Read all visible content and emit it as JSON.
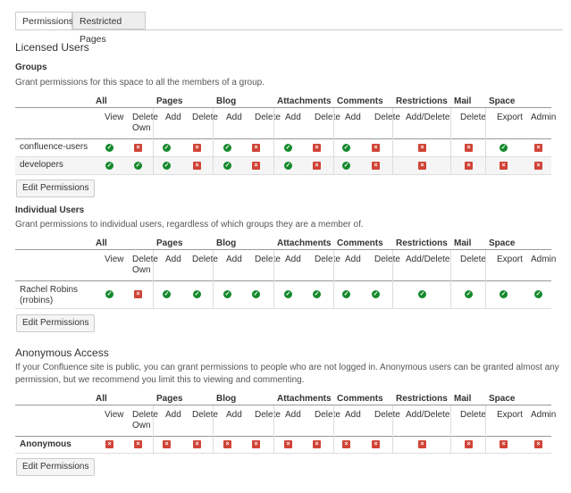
{
  "tabs": [
    {
      "label": "Permissions",
      "active": true
    },
    {
      "label": "Restricted Pages",
      "active": false
    }
  ],
  "licensed_title": "Licensed Users",
  "columns": {
    "groups": [
      "All",
      "Pages",
      "Blog",
      "Attachments",
      "Comments",
      "Restrictions",
      "Mail",
      "Space"
    ],
    "sub": [
      "View",
      "Delete Own",
      "Add",
      "Delete",
      "Add",
      "Delete",
      "Add",
      "Delete",
      "Add",
      "Delete",
      "Add/Delete",
      "Delete",
      "Export",
      "Admin"
    ]
  },
  "sections": [
    {
      "title": "Groups",
      "desc": "Grant permissions for this space to all the members of a group.",
      "rows": [
        {
          "name": "confluence-users",
          "perms": [
            1,
            0,
            1,
            0,
            1,
            0,
            1,
            0,
            1,
            0,
            0,
            0,
            1,
            0
          ]
        },
        {
          "name": "developers",
          "perms": [
            1,
            1,
            1,
            0,
            1,
            0,
            1,
            0,
            1,
            0,
            0,
            0,
            0,
            0
          ]
        }
      ],
      "button": "Edit Permissions"
    },
    {
      "title": "Individual Users",
      "desc": "Grant permissions to individual users, regardless of which groups they are a member of.",
      "rows": [
        {
          "name": "Rachel Robins",
          "name2": "(rrobins)",
          "perms": [
            1,
            0,
            1,
            1,
            1,
            1,
            1,
            1,
            1,
            1,
            1,
            1,
            1,
            1
          ]
        }
      ],
      "button": "Edit Permissions"
    },
    {
      "title": "Anonymous Access",
      "desc": "If your Confluence site is public, you can grant permissions to people who are not logged in. Anonymous users can be granted almost any permission, but we recommend you limit this to viewing and commenting.",
      "rows": [
        {
          "name": "Anonymous",
          "perms": [
            0,
            0,
            0,
            0,
            0,
            0,
            0,
            0,
            0,
            0,
            0,
            0,
            0,
            0
          ]
        }
      ],
      "button": "Edit Permissions"
    }
  ],
  "colors": {
    "granted": "#14892c",
    "denied": "#d04437"
  },
  "icons": {
    "granted": "check-circle-icon",
    "denied": "cross-square-icon"
  }
}
